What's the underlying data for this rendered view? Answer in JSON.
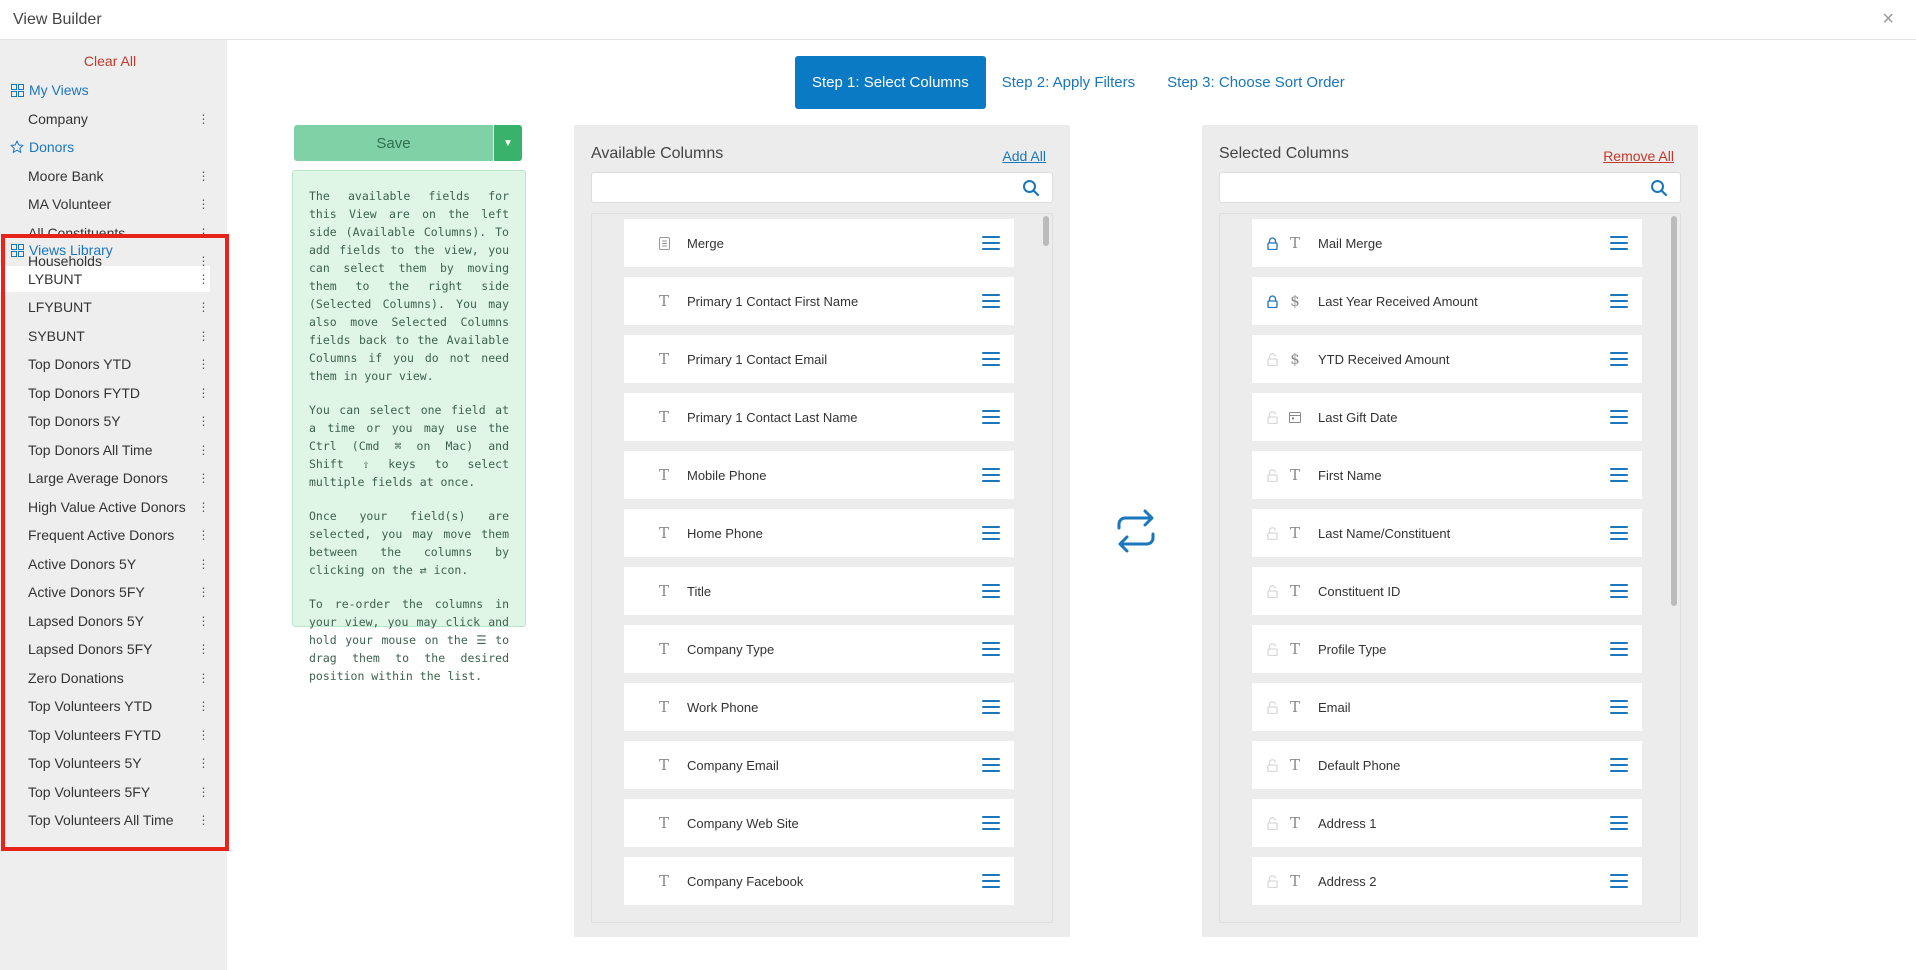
{
  "window": {
    "title": "View Builder",
    "close_glyph": "×"
  },
  "sidebar": {
    "clear_all": "Clear All",
    "my_views": {
      "label": "My Views",
      "icon": "grid-icon",
      "items": [
        "Company"
      ]
    },
    "donors": {
      "label": "Donors",
      "icon": "star-icon",
      "items": [
        "Moore Bank",
        "MA Volunteer",
        "All Constituents",
        "Households"
      ]
    },
    "views_library": {
      "label": "Views Library",
      "icon": "grid-icon",
      "active_index": 0,
      "items": [
        "LYBUNT",
        "LFYBUNT",
        "SYBUNT",
        "Top Donors YTD",
        "Top Donors FYTD",
        "Top Donors 5Y",
        "Top Donors All Time",
        "Large Average Donors",
        "High Value Active Donors",
        "Frequent Active Donors",
        "Active Donors 5Y",
        "Active Donors 5FY",
        "Lapsed Donors 5Y",
        "Lapsed Donors 5FY",
        "Zero Donations",
        "Top Volunteers YTD",
        "Top Volunteers FYTD",
        "Top Volunteers 5Y",
        "Top Volunteers 5FY",
        "Top Volunteers All Time"
      ]
    },
    "highlight_color": "#e8231a"
  },
  "steps": [
    {
      "label": "Step 1: Select Columns",
      "active": true
    },
    {
      "label": "Step 2: Apply Filters",
      "active": false
    },
    {
      "label": "Step 3: Choose Sort Order",
      "active": false
    }
  ],
  "save": {
    "label": "Save"
  },
  "help": {
    "paragraphs": [
      "The available fields for this View are on the left side (Available Columns). To add fields to the view, you can select them by moving them to the right side (Selected Columns). You may also move Selected Columns fields back to the Available Columns if you do not need them in your view.",
      "You can select one field at a time or you may use the Ctrl (Cmd ⌘ on Mac) and Shift ⇧ keys to select multiple fields at once.",
      "Once your field(s) are selected, you may move them between the columns by clicking on the ⇄ icon.",
      "To re-order the columns in your view, you may click and hold your mouse on the ☰ to drag them to the desired position within the list."
    ]
  },
  "available": {
    "title": "Available Columns",
    "action": "Add All",
    "search_placeholder": "",
    "items": [
      {
        "label": "Merge",
        "type": "merge-icon"
      },
      {
        "label": "Primary 1 Contact First Name",
        "type": "text-icon"
      },
      {
        "label": "Primary 1 Contact Email",
        "type": "text-icon"
      },
      {
        "label": "Primary 1 Contact Last Name",
        "type": "text-icon"
      },
      {
        "label": "Mobile Phone",
        "type": "text-icon"
      },
      {
        "label": "Home Phone",
        "type": "text-icon"
      },
      {
        "label": "Title",
        "type": "text-icon"
      },
      {
        "label": "Company Type",
        "type": "text-icon"
      },
      {
        "label": "Work Phone",
        "type": "text-icon"
      },
      {
        "label": "Company Email",
        "type": "text-icon"
      },
      {
        "label": "Company Web Site",
        "type": "text-icon"
      },
      {
        "label": "Company Facebook",
        "type": "text-icon"
      }
    ]
  },
  "selected": {
    "title": "Selected Columns",
    "action": "Remove All",
    "search_placeholder": "",
    "items": [
      {
        "label": "Mail Merge",
        "type": "text-icon",
        "locked": true
      },
      {
        "label": "Last Year Received Amount",
        "type": "dollar-icon",
        "locked": true
      },
      {
        "label": "YTD Received Amount",
        "type": "dollar-icon",
        "locked": false
      },
      {
        "label": "Last Gift Date",
        "type": "calendar-icon",
        "locked": false
      },
      {
        "label": "First Name",
        "type": "text-icon",
        "locked": false
      },
      {
        "label": "Last Name/Constituent",
        "type": "text-icon",
        "locked": false
      },
      {
        "label": "Constituent ID",
        "type": "text-icon",
        "locked": false
      },
      {
        "label": "Profile Type",
        "type": "text-icon",
        "locked": false
      },
      {
        "label": "Email",
        "type": "text-icon",
        "locked": false
      },
      {
        "label": "Default Phone",
        "type": "text-icon",
        "locked": false
      },
      {
        "label": "Address 1",
        "type": "text-icon",
        "locked": false
      },
      {
        "label": "Address 2",
        "type": "text-icon",
        "locked": false
      }
    ]
  },
  "colors": {
    "accent": "#0b7ac4",
    "link": "#1a76bd",
    "danger": "#c0392b",
    "save": "#80d2a6"
  }
}
